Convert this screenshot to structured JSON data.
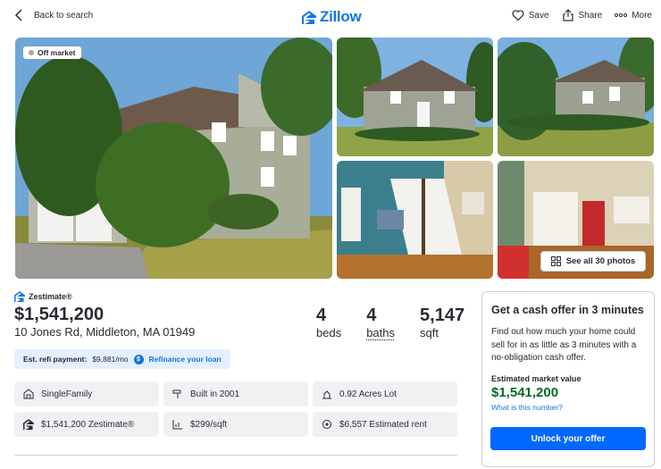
{
  "topbar": {
    "back_label": "Back to search",
    "logo_text": "Zillow",
    "save_label": "Save",
    "share_label": "Share",
    "more_label": "More"
  },
  "photos": {
    "status_badge": "Off market",
    "see_all_label": "See all 30 photos"
  },
  "listing": {
    "zestimate_label": "Zestimate®",
    "price": "$1,541,200",
    "address": "10 Jones Rd, Middleton, MA 01949",
    "beds_value": "4",
    "beds_label": "beds",
    "baths_value": "4",
    "baths_label": "baths",
    "sqft_value": "5,147",
    "sqft_label": "sqft"
  },
  "refi": {
    "label": "Est. refi payment:",
    "amount": "$9,881/mo",
    "link": "Refinance your loan"
  },
  "facts": [
    {
      "icon": "house-icon",
      "text": "SingleFamily"
    },
    {
      "icon": "hammer-icon",
      "text": "Built in 2001"
    },
    {
      "icon": "lot-icon",
      "text": "0.92 Acres Lot"
    },
    {
      "icon": "zestimate-icon",
      "text": "$1,541,200 Zestimate®"
    },
    {
      "icon": "price-sqft-icon",
      "text": "$299/sqft"
    },
    {
      "icon": "rent-icon",
      "text": "$6,557 Estimated rent"
    }
  ],
  "cash_offer": {
    "title": "Get a cash offer in 3 minutes",
    "body": "Find out how much your home could sell for in as little as 3 minutes with a no-obligation cash offer.",
    "est_label": "Estimated market value",
    "est_value": "$1,541,200",
    "link": "What is this number?",
    "button": "Unlock your offer"
  },
  "colors": {
    "brand_blue": "#1277e1",
    "button_blue": "#0068ff",
    "value_green": "#006b29"
  }
}
